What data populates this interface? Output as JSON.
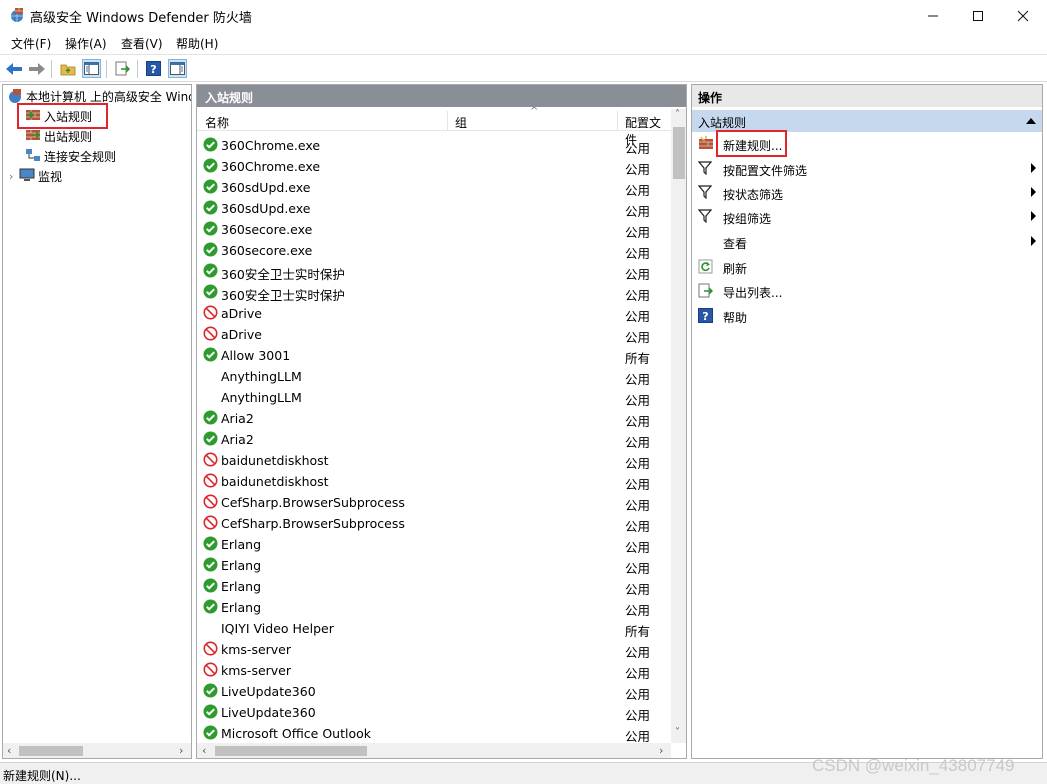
{
  "window": {
    "title": "高级安全 Windows Defender 防火墙",
    "icon": "firewall-icon"
  },
  "menu": {
    "file": "文件(F)",
    "action": "操作(A)",
    "view": "查看(V)",
    "help": "帮助(H)"
  },
  "tree": {
    "root": "本地计算机 上的高级安全 Windows",
    "inbound": "入站规则",
    "outbound": "出站规则",
    "connection_security": "连接安全规则",
    "monitoring": "监视"
  },
  "center": {
    "header": "入站规则",
    "columns": {
      "name": "名称",
      "group": "组",
      "profile": "配置文件"
    },
    "rows": [
      {
        "status": "allow",
        "name": "360Chrome.exe",
        "profile": "公用"
      },
      {
        "status": "allow",
        "name": "360Chrome.exe",
        "profile": "公用"
      },
      {
        "status": "allow",
        "name": "360sdUpd.exe",
        "profile": "公用"
      },
      {
        "status": "allow",
        "name": "360sdUpd.exe",
        "profile": "公用"
      },
      {
        "status": "allow",
        "name": "360secore.exe",
        "profile": "公用"
      },
      {
        "status": "allow",
        "name": "360secore.exe",
        "profile": "公用"
      },
      {
        "status": "allow",
        "name": "360安全卫士实时保护",
        "profile": "公用"
      },
      {
        "status": "allow",
        "name": "360安全卫士实时保护",
        "profile": "公用"
      },
      {
        "status": "block",
        "name": "aDrive",
        "profile": "公用"
      },
      {
        "status": "block",
        "name": "aDrive",
        "profile": "公用"
      },
      {
        "status": "allow",
        "name": "Allow 3001",
        "profile": "所有"
      },
      {
        "status": "none",
        "name": "AnythingLLM",
        "profile": "公用"
      },
      {
        "status": "none",
        "name": "AnythingLLM",
        "profile": "公用"
      },
      {
        "status": "allow",
        "name": "Aria2",
        "profile": "公用"
      },
      {
        "status": "allow",
        "name": "Aria2",
        "profile": "公用"
      },
      {
        "status": "block",
        "name": "baidunetdiskhost",
        "profile": "公用"
      },
      {
        "status": "block",
        "name": "baidunetdiskhost",
        "profile": "公用"
      },
      {
        "status": "block",
        "name": "CefSharp.BrowserSubprocess",
        "profile": "公用"
      },
      {
        "status": "block",
        "name": "CefSharp.BrowserSubprocess",
        "profile": "公用"
      },
      {
        "status": "allow",
        "name": "Erlang",
        "profile": "公用"
      },
      {
        "status": "allow",
        "name": "Erlang",
        "profile": "公用"
      },
      {
        "status": "allow",
        "name": "Erlang",
        "profile": "公用"
      },
      {
        "status": "allow",
        "name": "Erlang",
        "profile": "公用"
      },
      {
        "status": "none",
        "name": "IQIYI Video Helper",
        "profile": "所有"
      },
      {
        "status": "block",
        "name": "kms-server",
        "profile": "公用"
      },
      {
        "status": "block",
        "name": "kms-server",
        "profile": "公用"
      },
      {
        "status": "allow",
        "name": "LiveUpdate360",
        "profile": "公用"
      },
      {
        "status": "allow",
        "name": "LiveUpdate360",
        "profile": "公用"
      },
      {
        "status": "allow",
        "name": "Microsoft Office Outlook",
        "profile": "公用"
      }
    ]
  },
  "actions": {
    "header": "操作",
    "section": "入站规则",
    "items": [
      {
        "label": "新建规则...",
        "icon": "new-rule-icon",
        "submenu": false
      },
      {
        "label": "按配置文件筛选",
        "icon": "filter-icon",
        "submenu": true
      },
      {
        "label": "按状态筛选",
        "icon": "filter-icon",
        "submenu": true
      },
      {
        "label": "按组筛选",
        "icon": "filter-icon",
        "submenu": true
      },
      {
        "label": "查看",
        "icon": "",
        "submenu": true
      },
      {
        "label": "刷新",
        "icon": "refresh-icon",
        "submenu": false
      },
      {
        "label": "导出列表...",
        "icon": "export-icon",
        "submenu": false
      },
      {
        "label": "帮助",
        "icon": "help-icon",
        "submenu": false
      }
    ]
  },
  "status": {
    "text": "新建规则(N)..."
  },
  "watermark": "CSDN @weixin_43807749",
  "colors": {
    "allow_green": "#2e9b2e",
    "block_red": "#d9262a",
    "highlight_red": "#e0262a",
    "header_gray": "#8a8f97",
    "section_blue": "#c5d8ed"
  }
}
